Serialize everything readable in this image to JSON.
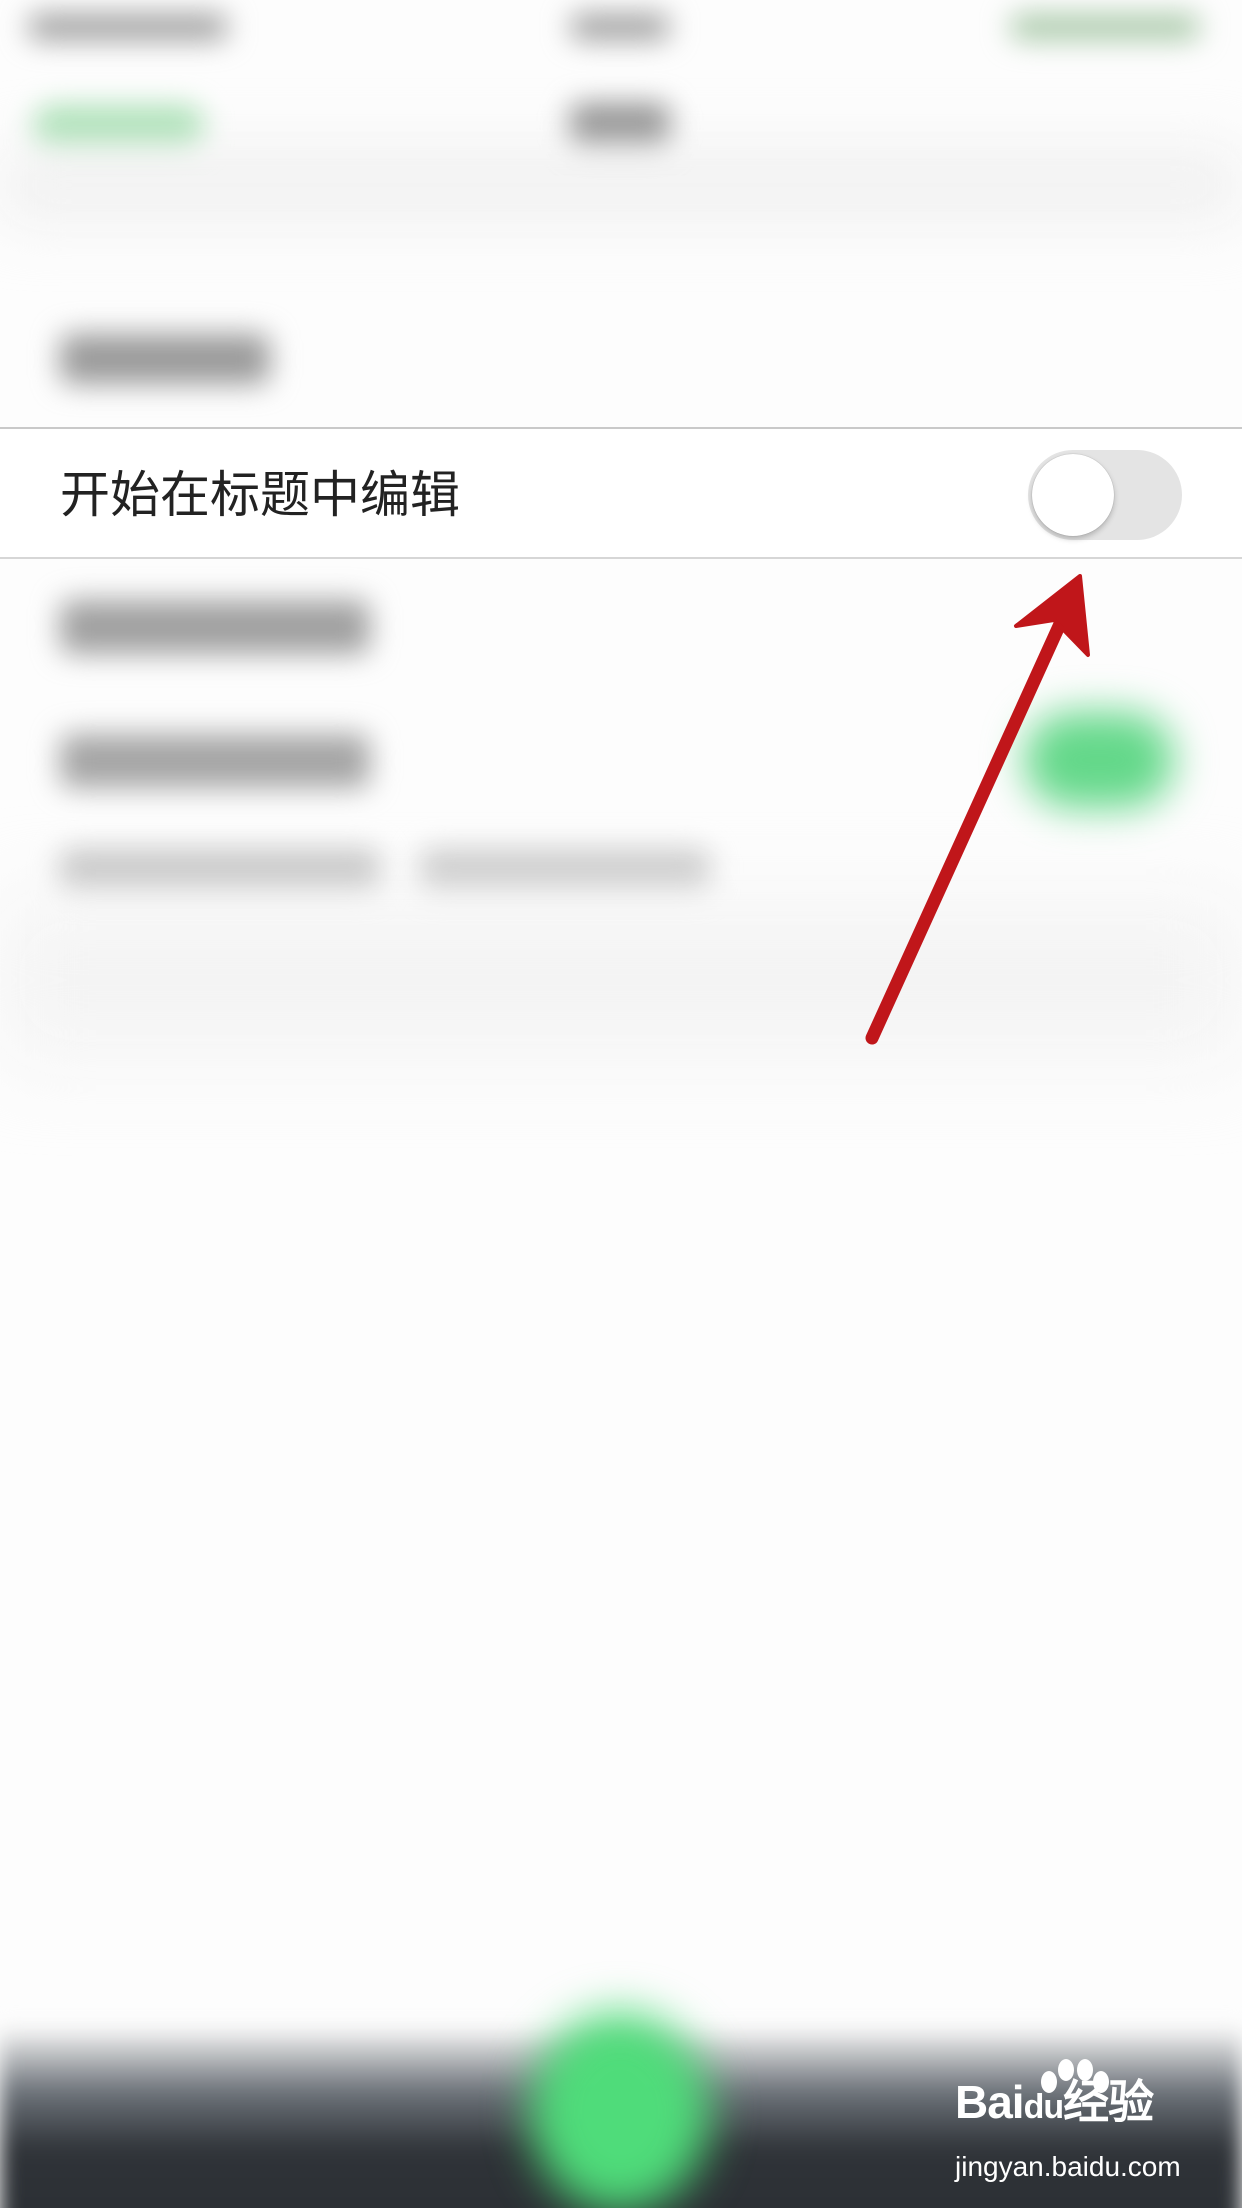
{
  "setting": {
    "label": "开始在标题中编辑",
    "toggle_on": false
  },
  "colors": {
    "toggle_off_track": "#e4e4e4",
    "annotation_arrow": "#c0161a",
    "blurred_accent_green": "#4fdc7a"
  },
  "annotation": {
    "type": "arrow",
    "points_to": "setting-toggle"
  },
  "watermark": {
    "brand_prefix": "Bai",
    "brand_mid": "du",
    "brand_suffix": "经验",
    "url": "jingyan.baidu.com"
  }
}
